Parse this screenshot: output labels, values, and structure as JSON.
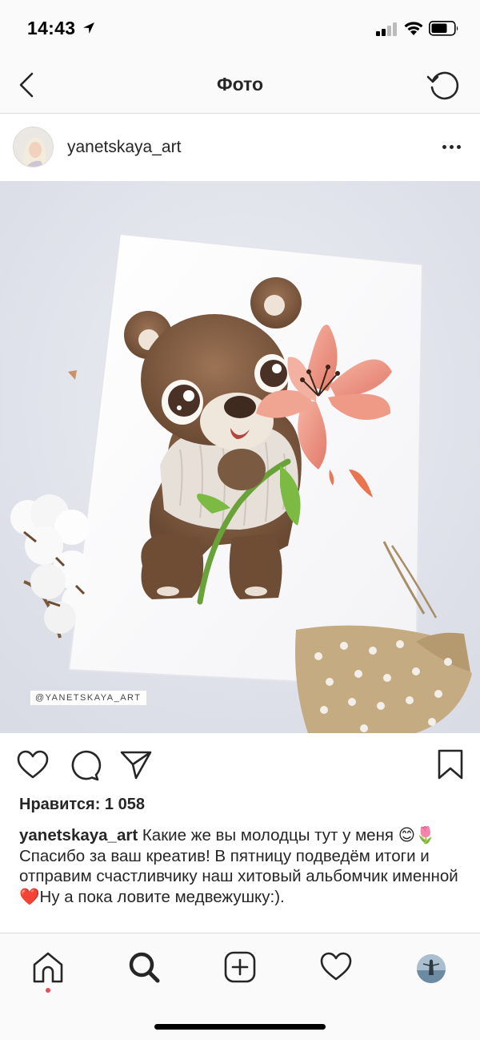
{
  "status_bar": {
    "time": "14:43"
  },
  "nav": {
    "title": "Фото"
  },
  "post": {
    "username": "yanetskaya_art",
    "photo_watermark": "@YANETSKAYA_ART",
    "likes": "Нравится: 1 058",
    "caption_user": "yanetskaya_art",
    "caption_text": " Какие же вы молодцы тут у меня 😊🌷 Спасибо за ваш креатив! В пятницу подведём итоги и отправим счастливчику наш хитовый альбомчик именной ❤️Ну а пока ловите медвежушку:)."
  },
  "icons": {
    "back": "chevron-left-icon",
    "refresh": "refresh-icon",
    "more": "more-dots-icon",
    "like": "heart-icon",
    "comment": "comment-icon",
    "share": "send-icon",
    "save": "bookmark-icon",
    "home": "home-icon",
    "search": "search-icon",
    "add": "add-post-icon",
    "activity": "heart-icon",
    "profile": "profile-avatar"
  },
  "colors": {
    "text": "#262626",
    "notification_dot": "#ed4956",
    "bar_bg": "#fafafa",
    "divider": "#dbdbdb"
  }
}
